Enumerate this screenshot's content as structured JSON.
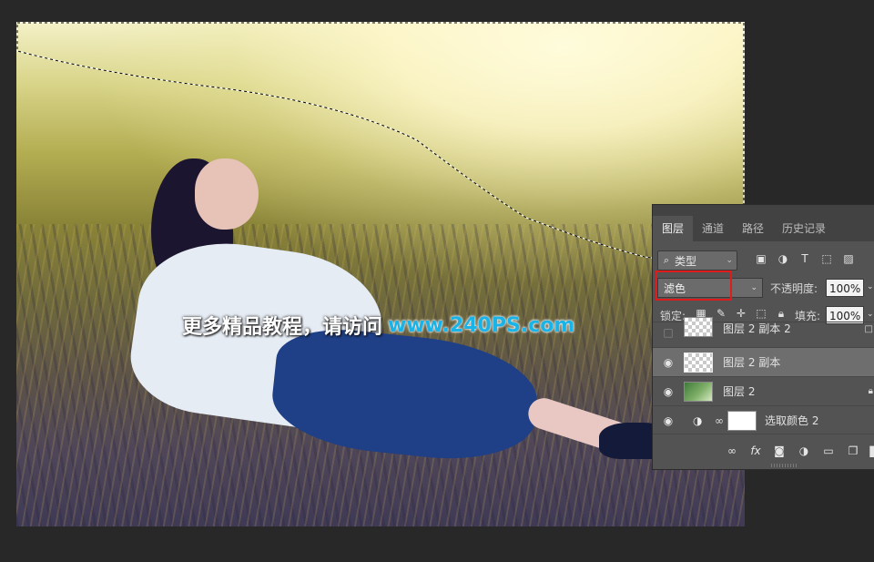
{
  "watermark": {
    "text_cn": "更多精品教程，请访问",
    "text_url": "www.240PS.com"
  },
  "panel": {
    "tabs": [
      {
        "label": "图层",
        "active": true
      },
      {
        "label": "通道",
        "active": false
      },
      {
        "label": "路径",
        "active": false
      },
      {
        "label": "历史记录",
        "active": false
      }
    ],
    "filter": {
      "label": "类型"
    },
    "blend_mode": "滤色",
    "opacity_label": "不透明度:",
    "opacity_value": "100%",
    "lock_label": "锁定:",
    "fill_label": "填充:",
    "fill_value": "100%",
    "layers": [
      {
        "name": "图层 2 副本 2",
        "visible": false,
        "selected": false,
        "thumb": "checker"
      },
      {
        "name": "图层 2 副本",
        "visible": true,
        "selected": true,
        "thumb": "checker"
      },
      {
        "name": "图层 2",
        "visible": true,
        "selected": false,
        "thumb": "green"
      },
      {
        "name": "选取颜色 2",
        "visible": true,
        "selected": false,
        "thumb": "adjustment"
      }
    ],
    "bottom_icons": [
      "link-icon",
      "fx-icon",
      "mask-icon",
      "adjustment-icon",
      "folder-icon",
      "new-layer-icon",
      "trash-icon"
    ],
    "bottom_fx_label": "fx"
  },
  "colors": {
    "panel_bg": "#535353",
    "selected_row": "#6e6e6e",
    "highlight_box": "#e01b1b",
    "watermark_url": "#19b3e8"
  }
}
